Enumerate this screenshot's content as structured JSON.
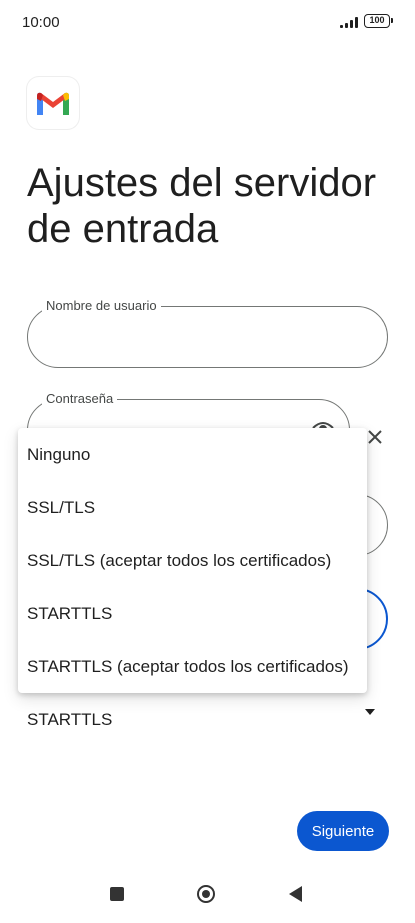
{
  "status_bar": {
    "time": "10:00",
    "battery": "100"
  },
  "page": {
    "title": "Ajustes del servidor de entrada"
  },
  "fields": {
    "username_label": "Nombre de usuario",
    "password_label": "Contraseña"
  },
  "security": {
    "selected": "STARTTLS",
    "options": [
      "Ninguno",
      "SSL/TLS",
      "SSL/TLS (aceptar todos los certificados)",
      "STARTTLS",
      "STARTTLS (aceptar todos los certificados)"
    ]
  },
  "actions": {
    "next_label": "Siguiente"
  },
  "colors": {
    "accent": "#0b57d0",
    "text": "#1f1f1f",
    "outline": "#747775"
  }
}
